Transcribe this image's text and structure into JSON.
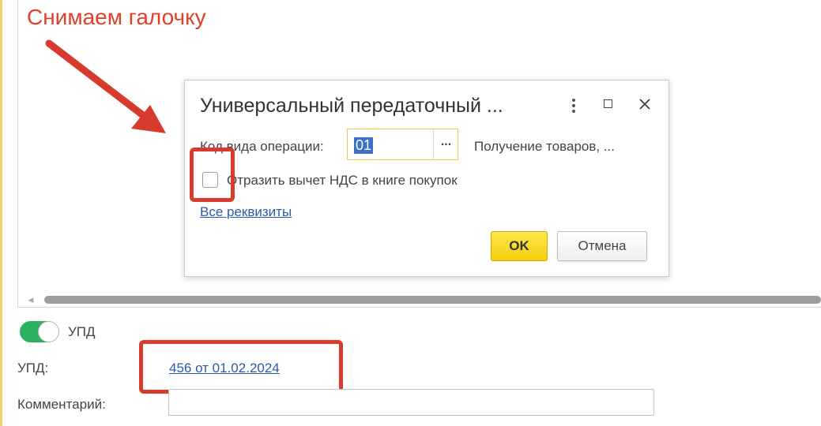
{
  "annotation": {
    "title": "Снимаем галочку",
    "color": "#e0402a"
  },
  "dialog": {
    "title": "Универсальный передаточный ...",
    "operation_code_label": "Код вида операции:",
    "operation_code_value": "01",
    "operation_select_label": "...",
    "operation_description": "Получение товаров, ...",
    "vat_checkbox_label": "Отразить вычет НДС в книге покупок",
    "vat_checked": false,
    "all_details_link": "Все реквизиты",
    "ok_label": "OK",
    "cancel_label": "Отмена"
  },
  "form": {
    "upd_toggle_label": "УПД",
    "upd_toggle_on": true,
    "upd_label": "УПД:",
    "upd_link": "456 от 01.02.2024",
    "comment_label": "Комментарий:",
    "comment_value": ""
  },
  "colors": {
    "accent_yellow": "#f4cf0b",
    "link_blue": "#2a5aa8",
    "toggle_green": "#2bb15f",
    "highlight_red": "#d93a2e"
  }
}
